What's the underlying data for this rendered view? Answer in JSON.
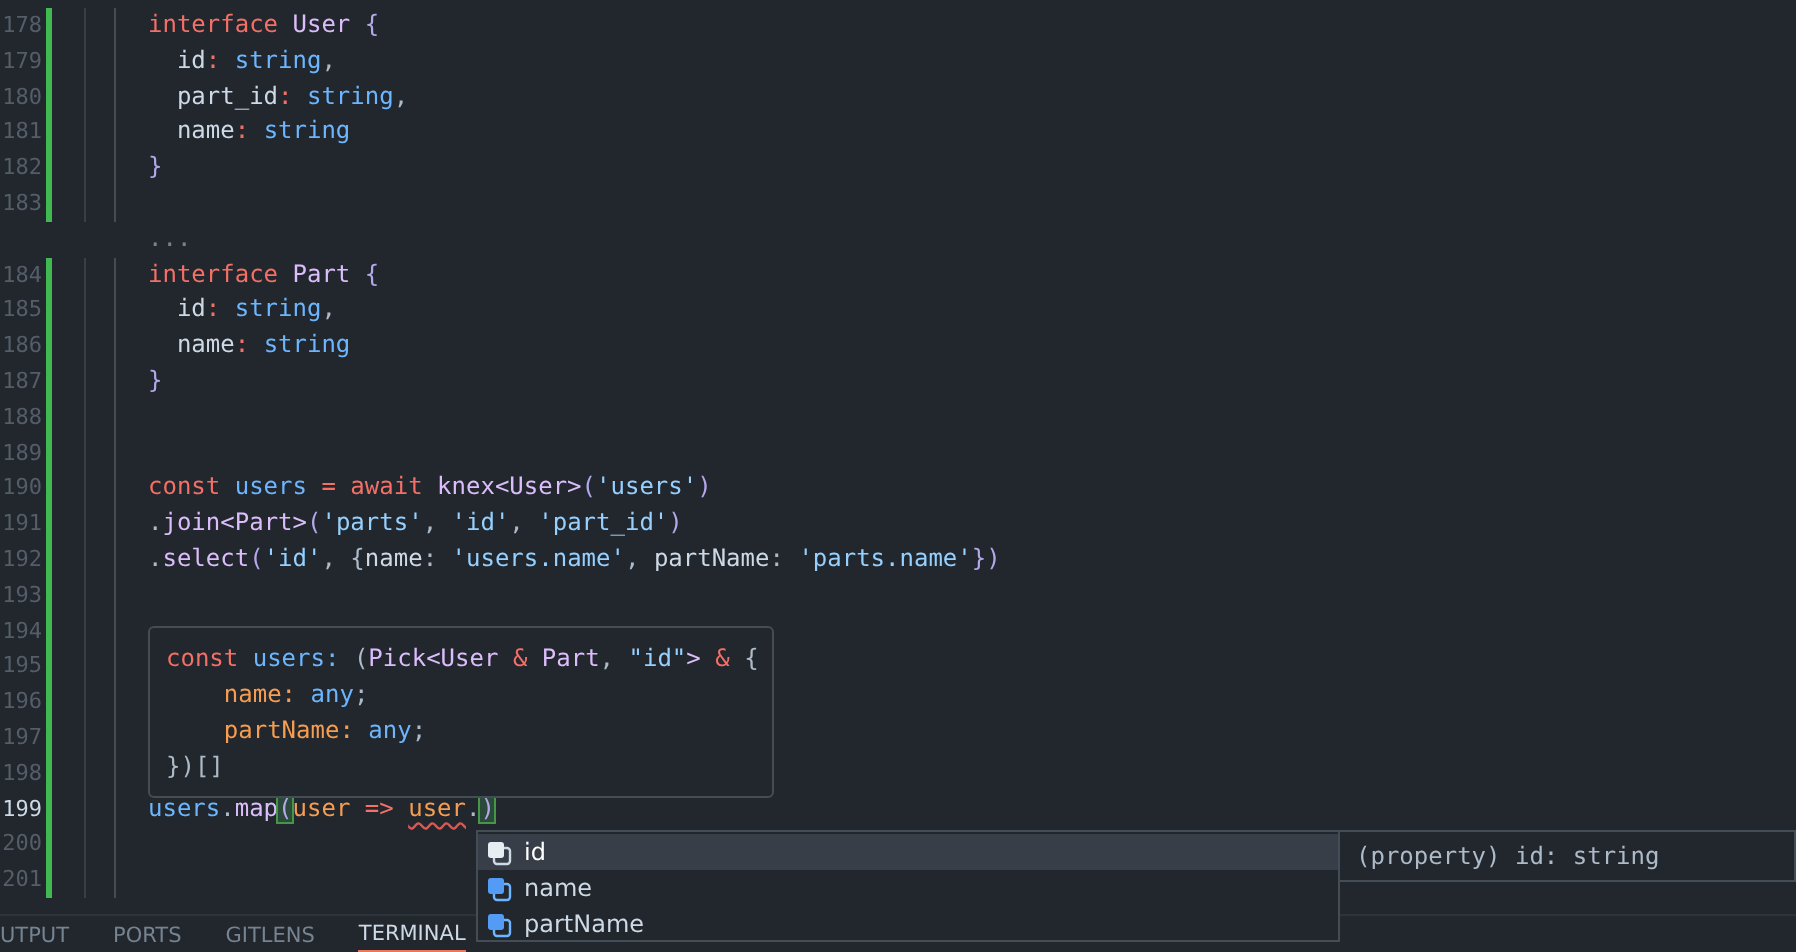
{
  "editor": {
    "lines": [
      {
        "number": "178",
        "modified": true,
        "tokens": [
          {
            "text": "interface ",
            "kind": "keyword"
          },
          {
            "text": "User",
            "kind": "type"
          },
          {
            "text": " {",
            "kind": "brace"
          }
        ]
      },
      {
        "number": "179",
        "modified": true,
        "tokens": [
          {
            "text": "  id",
            "kind": "prop"
          },
          {
            "text": ": ",
            "kind": "keyword"
          },
          {
            "text": "string",
            "kind": "builtin"
          },
          {
            "text": ",",
            "kind": "punct"
          }
        ]
      },
      {
        "number": "180",
        "modified": true,
        "tokens": [
          {
            "text": "  part_id",
            "kind": "prop"
          },
          {
            "text": ": ",
            "kind": "keyword"
          },
          {
            "text": "string",
            "kind": "builtin"
          },
          {
            "text": ",",
            "kind": "punct"
          }
        ]
      },
      {
        "number": "181",
        "modified": true,
        "tokens": [
          {
            "text": "  name",
            "kind": "prop"
          },
          {
            "text": ": ",
            "kind": "keyword"
          },
          {
            "text": "string",
            "kind": "builtin"
          }
        ]
      },
      {
        "number": "182",
        "modified": true,
        "tokens": [
          {
            "text": "}",
            "kind": "brace"
          }
        ]
      },
      {
        "number": "183",
        "modified": true
      },
      {
        "kind": "fold",
        "tokens": [
          {
            "text": "...",
            "kind": "comment"
          }
        ]
      },
      {
        "number": "184",
        "modified": true,
        "tokens": [
          {
            "text": "interface ",
            "kind": "keyword"
          },
          {
            "text": "Part",
            "kind": "type"
          },
          {
            "text": " {",
            "kind": "brace"
          }
        ]
      },
      {
        "number": "185",
        "modified": true,
        "tokens": [
          {
            "text": "  id",
            "kind": "prop"
          },
          {
            "text": ": ",
            "kind": "keyword"
          },
          {
            "text": "string",
            "kind": "builtin"
          },
          {
            "text": ",",
            "kind": "punct"
          }
        ]
      },
      {
        "number": "186",
        "modified": true,
        "tokens": [
          {
            "text": "  name",
            "kind": "prop"
          },
          {
            "text": ": ",
            "kind": "keyword"
          },
          {
            "text": "string",
            "kind": "builtin"
          }
        ]
      },
      {
        "number": "187",
        "modified": true,
        "tokens": [
          {
            "text": "}",
            "kind": "brace"
          }
        ]
      },
      {
        "number": "188",
        "modified": true
      },
      {
        "number": "189",
        "modified": true
      },
      {
        "number": "190",
        "modified": true,
        "tokens": [
          {
            "text": "const ",
            "kind": "keyword"
          },
          {
            "text": "users",
            "kind": "var"
          },
          {
            "text": " = ",
            "kind": "keyword"
          },
          {
            "text": "await ",
            "kind": "keyword"
          },
          {
            "text": "knex",
            "kind": "func"
          },
          {
            "text": "<User>",
            "kind": "type"
          },
          {
            "text": "(",
            "kind": "brace"
          },
          {
            "text": "'users'",
            "kind": "string"
          },
          {
            "text": ")",
            "kind": "brace"
          }
        ]
      },
      {
        "number": "191",
        "modified": true,
        "tokens": [
          {
            "text": ".",
            "kind": "punct"
          },
          {
            "text": "join",
            "kind": "func"
          },
          {
            "text": "<Part>",
            "kind": "type"
          },
          {
            "text": "(",
            "kind": "brace"
          },
          {
            "text": "'parts'",
            "kind": "string"
          },
          {
            "text": ", ",
            "kind": "punct"
          },
          {
            "text": "'id'",
            "kind": "string"
          },
          {
            "text": ", ",
            "kind": "punct"
          },
          {
            "text": "'part_id'",
            "kind": "string"
          },
          {
            "text": ")",
            "kind": "brace"
          }
        ]
      },
      {
        "number": "192",
        "modified": true,
        "tokens": [
          {
            "text": ".",
            "kind": "punct"
          },
          {
            "text": "select",
            "kind": "func"
          },
          {
            "text": "(",
            "kind": "brace"
          },
          {
            "text": "'id'",
            "kind": "string"
          },
          {
            "text": ", {",
            "kind": "punct"
          },
          {
            "text": "name",
            "kind": "prop"
          },
          {
            "text": ": ",
            "kind": "punct"
          },
          {
            "text": "'users.name'",
            "kind": "string"
          },
          {
            "text": ", ",
            "kind": "punct"
          },
          {
            "text": "partName",
            "kind": "prop"
          },
          {
            "text": ": ",
            "kind": "punct"
          },
          {
            "text": "'parts.name'",
            "kind": "string"
          },
          {
            "text": "})",
            "kind": "brace"
          }
        ]
      },
      {
        "number": "193",
        "modified": true
      },
      {
        "number": "194",
        "modified": true
      },
      {
        "number": "195",
        "modified": true
      },
      {
        "number": "196",
        "modified": true
      },
      {
        "number": "197",
        "modified": true
      },
      {
        "number": "198",
        "modified": true
      },
      {
        "number": "199",
        "modified": true,
        "current": true,
        "tokens": [
          {
            "text": "users",
            "kind": "var"
          },
          {
            "text": ".",
            "kind": "punct"
          },
          {
            "text": "map",
            "kind": "func"
          },
          {
            "text": "(",
            "kind": "brace",
            "bracket_match": true
          },
          {
            "text": "user",
            "kind": "param"
          },
          {
            "text": " => ",
            "kind": "keyword"
          },
          {
            "text": "user",
            "kind": "param",
            "squiggle": true
          },
          {
            "text": ".",
            "kind": "punct"
          },
          {
            "text": ")",
            "kind": "brace",
            "bracket_match": true
          }
        ]
      },
      {
        "number": "200",
        "modified": true
      },
      {
        "number": "201",
        "modified": true
      }
    ]
  },
  "hover": {
    "lines": [
      [
        {
          "text": "const ",
          "kind": "keyword"
        },
        {
          "text": "users",
          "kind": "var"
        },
        {
          "text": ": ",
          "kind": "var"
        },
        {
          "text": "(",
          "kind": "punct"
        },
        {
          "text": "Pick",
          "kind": "type"
        },
        {
          "text": "<User ",
          "kind": "type"
        },
        {
          "text": "&",
          "kind": "keyword"
        },
        {
          "text": " Part",
          "kind": "type"
        },
        {
          "text": ", ",
          "kind": "punct"
        },
        {
          "text": "\"id\"",
          "kind": "string"
        },
        {
          "text": "> ",
          "kind": "type"
        },
        {
          "text": "&",
          "kind": "keyword"
        },
        {
          "text": " {",
          "kind": "punct"
        }
      ],
      [
        {
          "text": "    name",
          "kind": "param"
        },
        {
          "text": ": ",
          "kind": "param"
        },
        {
          "text": "any",
          "kind": "builtin"
        },
        {
          "text": ";",
          "kind": "punct"
        }
      ],
      [
        {
          "text": "    partName",
          "kind": "param"
        },
        {
          "text": ": ",
          "kind": "param"
        },
        {
          "text": "any",
          "kind": "builtin"
        },
        {
          "text": ";",
          "kind": "punct"
        }
      ],
      [
        {
          "text": "})[]",
          "kind": "punct"
        }
      ]
    ]
  },
  "suggest": {
    "items": [
      {
        "label": "id",
        "selected": true
      },
      {
        "label": "name",
        "selected": false
      },
      {
        "label": "partName",
        "selected": false
      }
    ],
    "detail": "(property) id: string"
  },
  "panel_tabs": [
    {
      "label": "UTPUT",
      "selected": false
    },
    {
      "label": "PORTS",
      "selected": false
    },
    {
      "label": "GITLENS",
      "selected": false
    },
    {
      "label": "TERMINAL",
      "selected": true
    }
  ]
}
